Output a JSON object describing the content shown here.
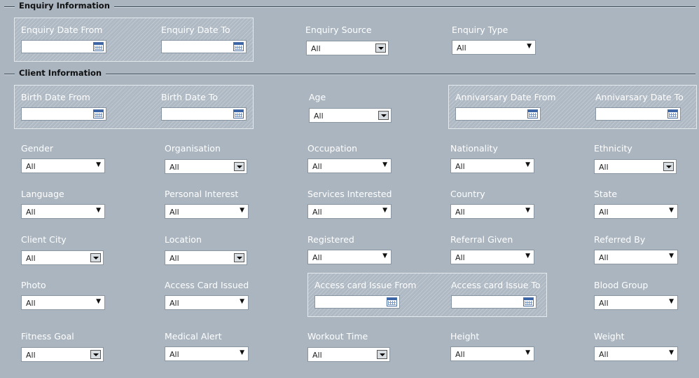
{
  "sections": {
    "enquiry": "Enquiry Information",
    "client": "Client Information"
  },
  "labels": {
    "enquiry_date_from": "Enquiry Date From",
    "enquiry_date_to": "Enquiry Date To",
    "enquiry_source": "Enquiry Source",
    "enquiry_type": "Enquiry Type",
    "birth_date_from": "Birth Date From",
    "birth_date_to": "Birth Date To",
    "age": "Age",
    "anniversary_date_from": "Annivarsary Date From",
    "anniversary_date_to": "Annivarsary Date To",
    "gender": "Gender",
    "organisation": "Organisation",
    "occupation": "Occupation",
    "nationality": "Nationality",
    "ethnicity": "Ethnicity",
    "language": "Language",
    "personal_interest": "Personal Interest",
    "services_interested": "Services Interested",
    "country": "Country",
    "state": "State",
    "client_city": "Client City",
    "location": "Location",
    "registered": "Registered",
    "referral_given": "Referral Given",
    "referred_by": "Referred By",
    "photo": "Photo",
    "access_card_issued": "Access Card Issued",
    "access_card_issue_from": "Access card Issue From",
    "access_card_issue_to": "Access card Issue To",
    "blood_group": "Blood Group",
    "fitness_goal": "Fitness Goal",
    "medical_alert": "Medical Alert",
    "workout_time": "Workout Time",
    "height": "Height",
    "weight": "Weight"
  },
  "values": {
    "enquiry_source": "All",
    "enquiry_type": "All",
    "age": "All",
    "gender": "All",
    "organisation": "All",
    "occupation": "All",
    "nationality": "All",
    "ethnicity": "All",
    "language": "All",
    "personal_interest": "All",
    "services_interested": "All",
    "country": "All",
    "state": "All",
    "client_city": "All",
    "location": "All",
    "registered": "All",
    "referral_given": "All",
    "referred_by": "All",
    "photo": "All",
    "access_card_issued": "All",
    "blood_group": "All",
    "fitness_goal": "All",
    "medical_alert": "All",
    "workout_time": "All",
    "height": "All",
    "weight": "All"
  }
}
